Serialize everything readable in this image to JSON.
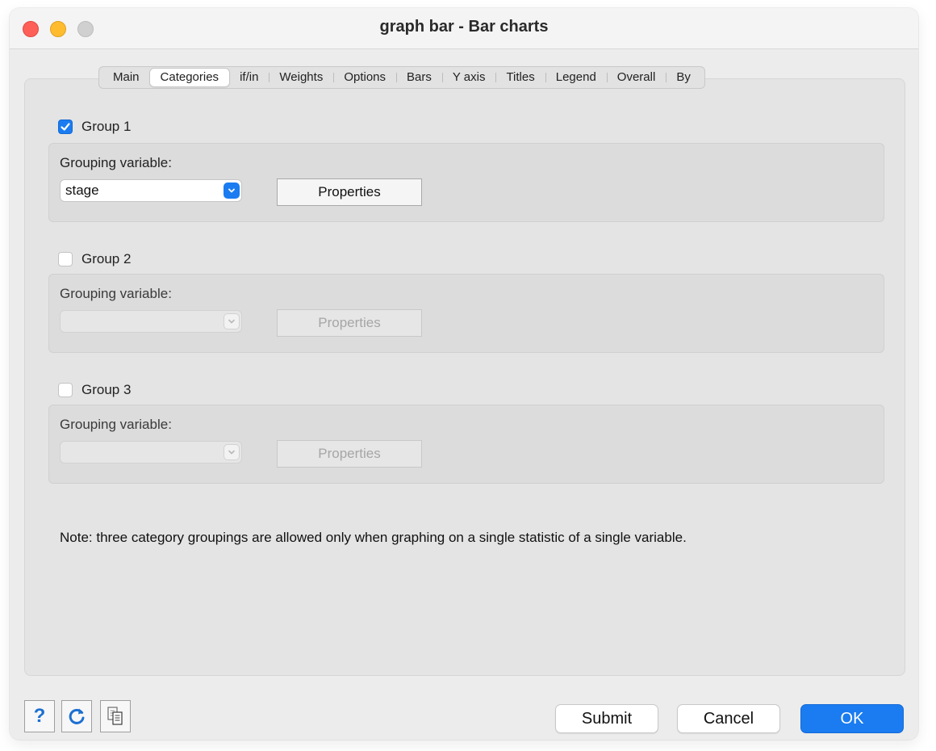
{
  "window": {
    "title": "graph bar - Bar charts"
  },
  "tabs": [
    {
      "label": "Main"
    },
    {
      "label": "Categories",
      "active": true
    },
    {
      "label": "if/in"
    },
    {
      "label": "Weights"
    },
    {
      "label": "Options"
    },
    {
      "label": "Bars"
    },
    {
      "label": "Y axis"
    },
    {
      "label": "Titles"
    },
    {
      "label": "Legend"
    },
    {
      "label": "Overall"
    },
    {
      "label": "By"
    }
  ],
  "groups": [
    {
      "label": "Group 1",
      "checked": true,
      "grouping_label": "Grouping variable:",
      "value": "stage",
      "properties_label": "Properties",
      "enabled": true
    },
    {
      "label": "Group 2",
      "checked": false,
      "grouping_label": "Grouping variable:",
      "value": "",
      "properties_label": "Properties",
      "enabled": false
    },
    {
      "label": "Group 3",
      "checked": false,
      "grouping_label": "Grouping variable:",
      "value": "",
      "properties_label": "Properties",
      "enabled": false
    }
  ],
  "note": "Note: three category groupings are allowed only when graphing on a single statistic of a single variable.",
  "footer": {
    "help_icon": "help-icon",
    "reset_icon": "refresh-icon",
    "copy_icon": "copy-command-icon",
    "help_text": "?",
    "submit_label": "Submit",
    "cancel_label": "Cancel",
    "ok_label": "OK"
  },
  "colors": {
    "accent": "#1a7cf0",
    "close": "#fe5f57",
    "minimize": "#febc2e"
  }
}
